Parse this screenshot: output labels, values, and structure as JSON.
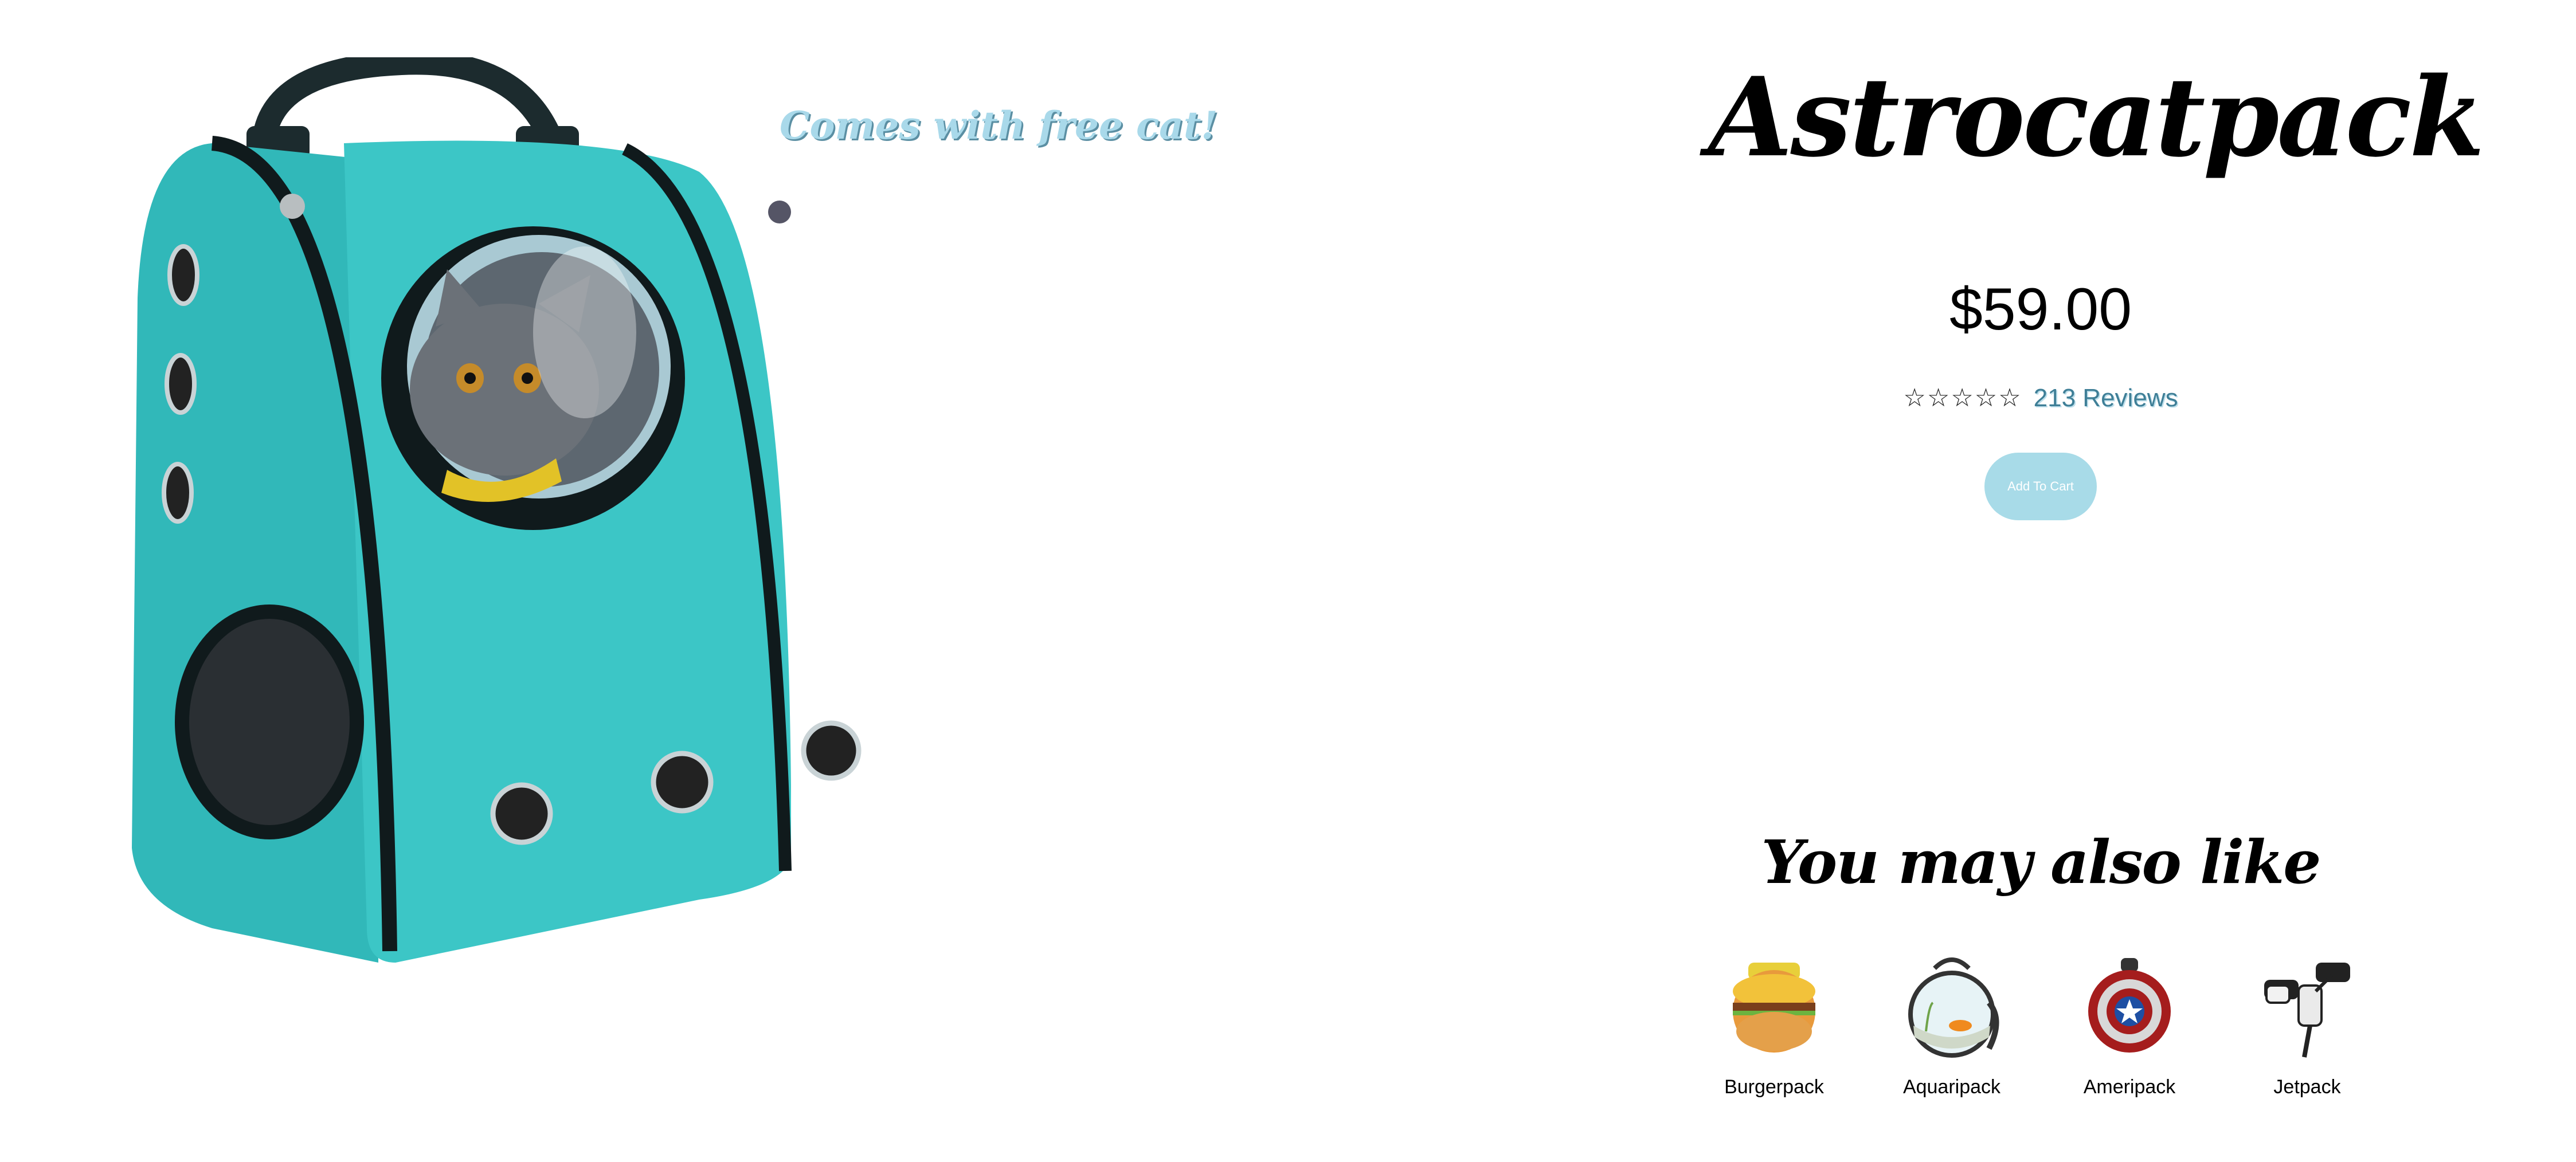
{
  "product": {
    "tagline": "Comes with free cat!",
    "title": "Astrocatpack",
    "price": "$59.00",
    "rating_stars": 0,
    "rating_max": 5,
    "reviews_label": "213 Reviews",
    "add_to_cart_label": "Add To Cart"
  },
  "recommendations": {
    "title": "You may also like",
    "items": [
      {
        "name": "Burgerpack"
      },
      {
        "name": "Aquaripack"
      },
      {
        "name": "Ameripack"
      },
      {
        "name": "Jetpack"
      }
    ]
  },
  "colors": {
    "accent": "#a8dbe8",
    "link": "#3f7f97",
    "backpack": "#3cc6c6"
  }
}
